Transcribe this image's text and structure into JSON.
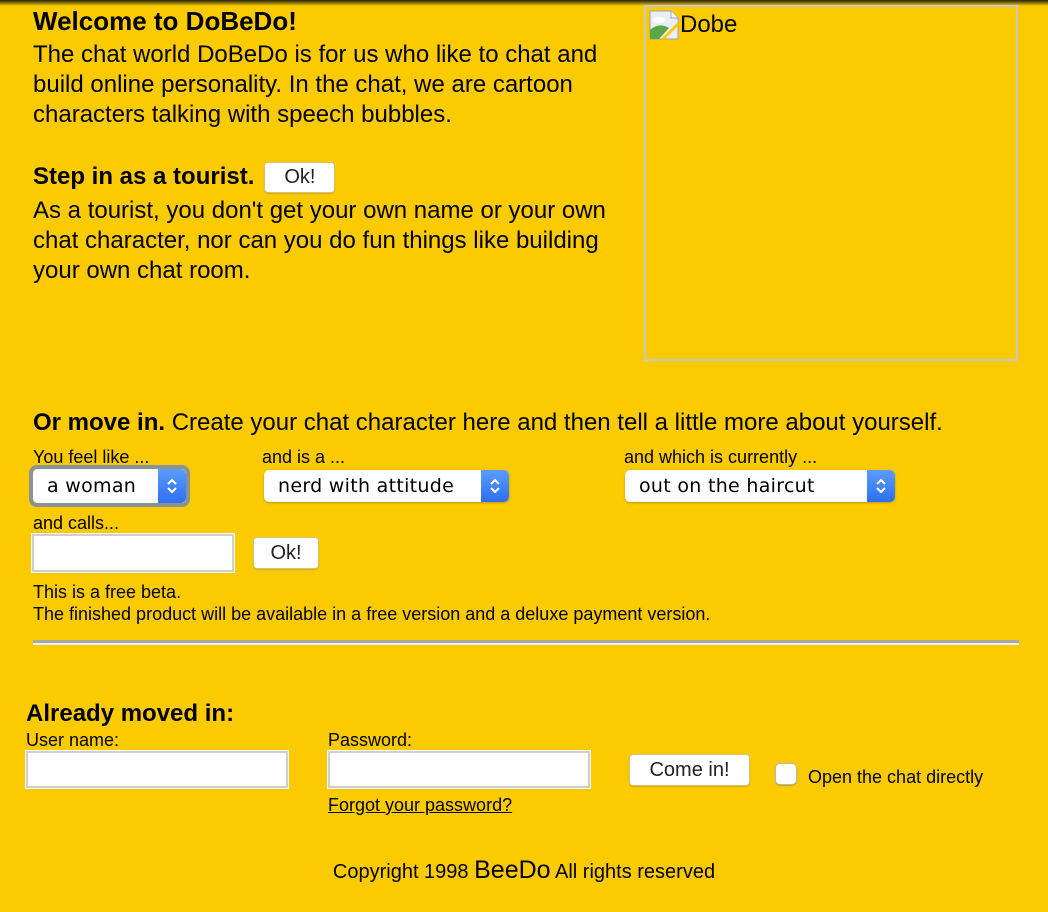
{
  "intro": {
    "title": "Welcome to DoBeDo!",
    "text": "The chat world DoBeDo is for us who like to chat and build online personality. In the chat, we are cartoon characters talking with speech bubbles."
  },
  "tourist": {
    "heading": "Step in as a tourist.",
    "ok_label": "Ok!",
    "text": "As a tourist, you don't get your own name or your own chat character, nor can you do fun things like building your own chat room."
  },
  "image": {
    "alt_text": "Dobe",
    "icon": "broken-image-icon"
  },
  "move_in": {
    "heading": "Or move in.",
    "text": " Create your chat character here and then tell a little more about yourself.",
    "feel_like": {
      "label": "You feel like ...",
      "selected": "a woman"
    },
    "is_a": {
      "label": "and is a ...",
      "selected": "nerd with attitude"
    },
    "currently": {
      "label": "and which is currently ...",
      "selected": "out on the haircut"
    },
    "calls": {
      "label": "and calls...",
      "value": "",
      "placeholder": ""
    },
    "ok_label": "Ok!",
    "beta_line1": "This is a free beta.",
    "beta_line2": "The finished product will be available in a free version and a deluxe payment version."
  },
  "login": {
    "heading": "Already moved in:",
    "username_label": "User name:",
    "username_value": "",
    "password_label": "Password:",
    "password_value": "",
    "forgot_link": "Forgot your password?",
    "submit_label": "Come in!",
    "open_chat_label": "Open the chat directly",
    "open_chat_checked": false
  },
  "footer": {
    "prefix": "Copyright 1998 ",
    "brand": "BeeDo",
    "suffix": " All rights reserved"
  },
  "colors": {
    "background": "#fbcb00",
    "select_arrow": "#2e6ff0"
  }
}
